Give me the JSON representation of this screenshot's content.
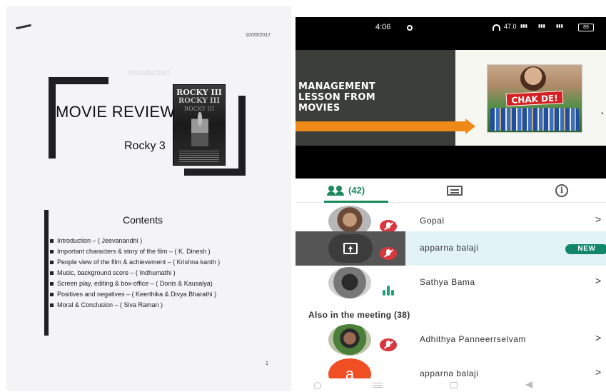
{
  "document": {
    "date": "10/26/2017",
    "ghost_text": "Introduction",
    "title": "MOVIE REVIEW",
    "subtitle": "Rocky 3",
    "poster": {
      "title": "ROCKY III",
      "title2": "ROCKY III",
      "title3": "ROCKY III"
    },
    "contents_title": "Contents",
    "contents": [
      "Introduction – ( Jeevanandhi )",
      "Important characters & story of the film – ( K. Dinesh )",
      "People view of the film & achievement – ( Krishna kanth )",
      "Music, background score – ( Indhumathi )",
      "Screen play, editing & box-office – ( Donis & Kausalya)",
      "Positives and negatives – ( Keerthika & Divya Bharathi )",
      "Moral & Conclusion – ( Siva Raman )"
    ],
    "page_number": "1"
  },
  "phone": {
    "status": {
      "time": "4:06",
      "speed": "47.0",
      "battery": "89"
    },
    "slide": {
      "text": "MANAGEMENT\nLESSON FROM\nMOVIES",
      "poster_logo": "CHAK DE!"
    },
    "tabs": {
      "people_count": "(42)"
    },
    "participants": [
      {
        "name": "Gopal",
        "chevron": ">"
      },
      {
        "name": "apparna balaji",
        "badge": "NEW"
      },
      {
        "name": "Sathya Bama",
        "chevron": ">"
      }
    ],
    "also_header": "Also in the meeting (38)",
    "also": [
      {
        "name": "Adhithya Panneerrselvam",
        "chevron": ">"
      },
      {
        "name": "apparna balaji",
        "chevron": ">",
        "avatar_letter": "a"
      }
    ]
  },
  "colors": {
    "accent_green": "#1a8a5a",
    "mute_red": "#d9363e",
    "slide_orange": "#ef8a1a",
    "new_badge": "#11866a"
  }
}
